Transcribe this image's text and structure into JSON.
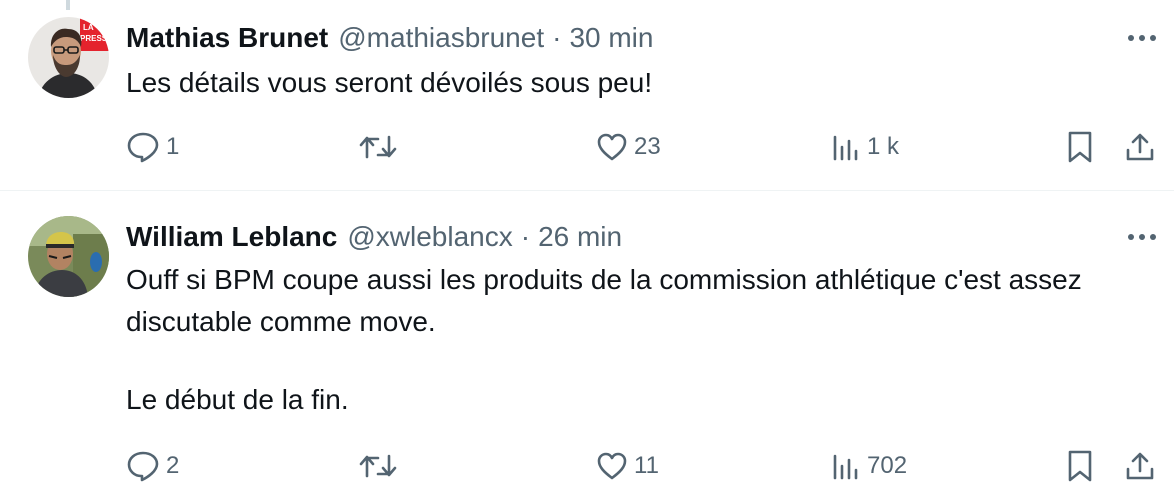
{
  "tweets": [
    {
      "author_name": "Mathias Brunet",
      "handle": "@mathiasbrunet",
      "separator": "·",
      "time": "30 min",
      "text_lines": [
        "Les détails vous seront dévoilés sous peu!"
      ],
      "avatar_badge": "LA PRESSE",
      "counts": {
        "replies": "1",
        "retweets": "",
        "likes": "23",
        "views": "1 k"
      }
    },
    {
      "author_name": "William Leblanc",
      "handle": "@xwleblancx",
      "separator": "·",
      "time": "26 min",
      "text_lines": [
        "Ouff si BPM coupe aussi les produits de la commission athlétique c'est assez discutable comme move.",
        "Le début de la fin."
      ],
      "counts": {
        "replies": "2",
        "retweets": "",
        "likes": "11",
        "views": "702"
      }
    }
  ],
  "icons": {
    "reply": "speech-bubble",
    "retweet": "retweet-arrows",
    "like": "heart",
    "views": "bar-chart",
    "bookmark": "bookmark",
    "share": "share-upload",
    "more": "three-dots"
  },
  "colors": {
    "text": "#0f1419",
    "secondary": "#536471",
    "divider": "#eff3f4",
    "brand_badge": "#e4232d"
  }
}
